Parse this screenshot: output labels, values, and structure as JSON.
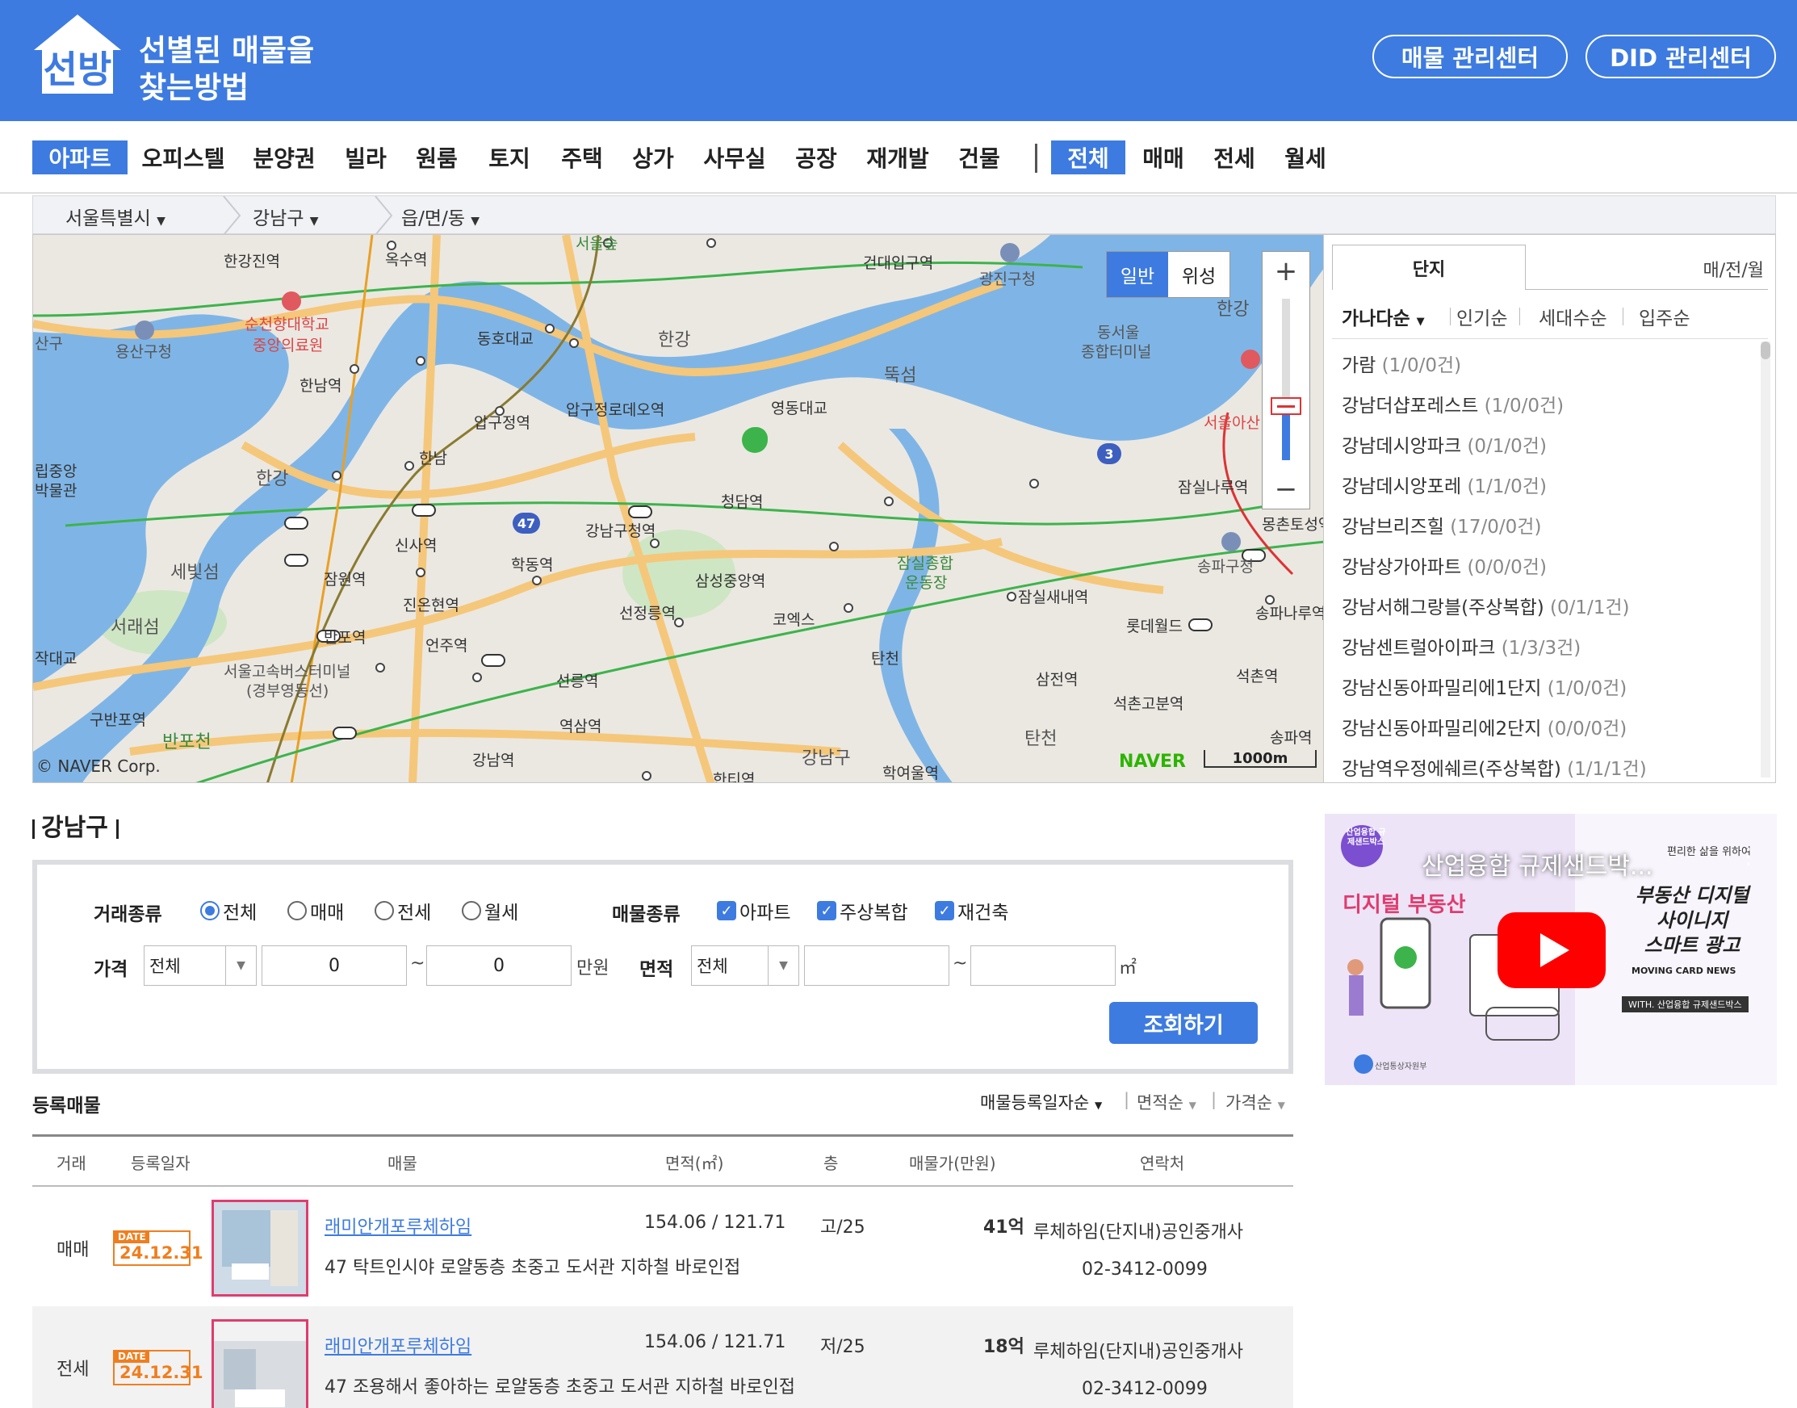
{
  "header": {
    "logo_text": "선방",
    "tagline_line1": "선별된 매물을",
    "tagline_line2": "찾는방법",
    "btn_manage": "매물 관리센터",
    "btn_did": "DID 관리센터"
  },
  "categories": [
    "아파트",
    "오피스텔",
    "분양권",
    "빌라",
    "원룸",
    "토지",
    "주택",
    "상가",
    "사무실",
    "공장",
    "재개발",
    "건물"
  ],
  "deal_types": [
    "전체",
    "매매",
    "전세",
    "월세"
  ],
  "location": {
    "city": "서울특별시",
    "district": "강남구",
    "dong": "읍/면/동"
  },
  "map": {
    "mode_normal": "일반",
    "mode_satellite": "위성",
    "zoom_in": "+",
    "zoom_out": "−",
    "copyright": "© NAVER Corp.",
    "brand": "NAVER",
    "scale": "1000m",
    "labels": [
      "서울숲",
      "옥수역",
      "한강진역",
      "건대입구역",
      "광진구청",
      "한강",
      "순천향대학교",
      "중앙의료원",
      "용산구청",
      "동호대교",
      "한강",
      "뚝섬",
      "동서울",
      "종합터미널",
      "서울아산",
      "한남역",
      "압구정역",
      "압구정로데오역",
      "영동대교",
      "47",
      "3",
      "한남",
      "한강",
      "청담역",
      "잠실나루역",
      "몽촌토성역",
      "신사역",
      "강남구청역",
      "잠실종합",
      "운동장",
      "송파구청",
      "세빛섬",
      "잠원역",
      "학동역",
      "삼성중앙역",
      "잠실새내역",
      "롯데월드",
      "송파나루역",
      "서래섬",
      "반포역",
      "진온현역",
      "선정릉역",
      "코엑스",
      "탄천",
      "석촌역",
      "작대교",
      "서울고속버스터미널",
      "(경부영동선)",
      "반포",
      "언주역",
      "선릉역",
      "삼전역",
      "석촌고분역",
      "구반포역",
      "반포천",
      "역삼역",
      "탄천",
      "송파역",
      "강남역",
      "강남구",
      "학여울역",
      "한티역",
      "산구",
      "립중앙",
      "박물관"
    ]
  },
  "panel": {
    "tab_active": "단지",
    "tab_right": "매/전/월",
    "sorts": [
      "가나다순",
      "인기순",
      "세대수순",
      "입주순"
    ],
    "items": [
      {
        "name": "가람",
        "count": "(1/0/0건)"
      },
      {
        "name": "강남더샵포레스트",
        "count": "(1/0/0건)"
      },
      {
        "name": "강남데시앙파크",
        "count": "(0/1/0건)"
      },
      {
        "name": "강남데시앙포레",
        "count": "(1/1/0건)"
      },
      {
        "name": "강남브리즈힐",
        "count": "(17/0/0건)"
      },
      {
        "name": "강남상가아파트",
        "count": "(0/0/0건)"
      },
      {
        "name": "강남서해그랑블(주상복합)",
        "count": "(0/1/1건)"
      },
      {
        "name": "강남센트럴아이파크",
        "count": "(1/3/3건)"
      },
      {
        "name": "강남신동아파밀리에1단지",
        "count": "(1/0/0건)"
      },
      {
        "name": "강남신동아파밀리에2단지",
        "count": "(0/0/0건)"
      },
      {
        "name": "강남역우정에쉐르(주상복합)",
        "count": "(1/1/1건)"
      }
    ]
  },
  "section_title": "강남구",
  "filter": {
    "deal_label": "거래종류",
    "deal_options": [
      "전체",
      "매매",
      "전세",
      "월세"
    ],
    "deal_selected": "전체",
    "type_label": "매물종류",
    "type_options": [
      "아파트",
      "주상복합",
      "재건축"
    ],
    "price_label": "가격",
    "price_select": "전체",
    "price_min": "0",
    "price_max": "0",
    "tilde": "~",
    "price_unit": "만원",
    "area_label": "면적",
    "area_select": "전체",
    "area_min": "",
    "area_max": "",
    "area_unit": "㎡",
    "search_button": "조회하기"
  },
  "video": {
    "title": "산업융합 규제샌드박...",
    "badge": "산업융합 규제샌드박스",
    "left_heading": "디지털 부동산",
    "right_top": "편리한 삶을 위하여",
    "right_heading1": "부동산 디지털",
    "right_heading2": "사이니지",
    "right_heading3": "스마트 광고",
    "news": "MOVING CARD NEWS",
    "with": "WITH. 산업융합 규제샌드박스",
    "ministry": "산업통상자원부"
  },
  "listings": {
    "heading": "등록매물",
    "sorts": [
      "매물등록일자순",
      "면적순",
      "가격순"
    ],
    "columns": [
      "거래",
      "등록일자",
      "매물",
      "면적(㎡)",
      "층",
      "매물가(만원)",
      "연락처"
    ],
    "rows": [
      {
        "deal": "매매",
        "date_tag": "DATE",
        "date": "24.12.31",
        "title": "래미안개포루체하임",
        "desc": "47 탁트인시야 로얄동층 초중고 도서관 지하철 바로인접",
        "area": "154.06 / 121.71",
        "floor": "고/25",
        "price": "41억",
        "agent": "루체하임(단지내)공인중개사",
        "phone": "02-3412-0099"
      },
      {
        "deal": "전세",
        "date_tag": "DATE",
        "date": "24.12.31",
        "title": "래미안개포루체하임",
        "desc": "47 조용해서 좋아하는 로얄동층 초중고 도서관 지하철 바로인접",
        "area": "154.06 / 121.71",
        "floor": "저/25",
        "price": "18억",
        "agent": "루체하임(단지내)공인중개사",
        "phone": "02-3412-0099"
      }
    ]
  }
}
